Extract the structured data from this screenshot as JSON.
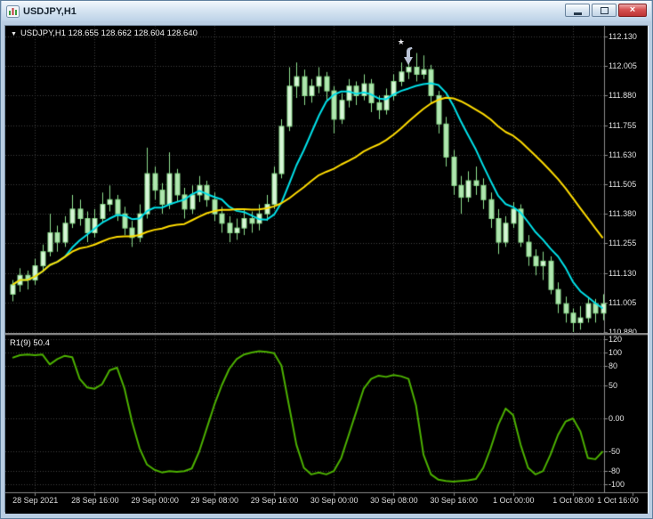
{
  "window": {
    "title": "USDJPY,H1"
  },
  "legend": {
    "collapse_glyph": "▼",
    "symbol": "USDJPY,H1",
    "ohlc": "128.655 128.662 128.604 128.640"
  },
  "theme": {
    "chart_bg": "#000000",
    "grid": "#3f3f3f",
    "separator": "#8a8a8a",
    "scale_text": "#e2e2e2",
    "candle_up_fill": "#d8f6d8",
    "candle_down_fill": "#b0e6b0",
    "candle_stroke": "#8cdc8c",
    "frame": "#b9cde2",
    "close_button_red": "#bc3434"
  },
  "chart_data": {
    "type": "candlestick",
    "symbol": "USDJPY",
    "timeframe": "H1",
    "price_axis": {
      "min": 110.88,
      "max": 112.13,
      "tick_step": 0.125,
      "labels": [
        {
          "text": "112.130",
          "value": 112.13
        },
        {
          "text": "112.005",
          "value": 112.005
        },
        {
          "text": "111.880",
          "value": 111.88
        },
        {
          "text": "111.755",
          "value": 111.755
        },
        {
          "text": "111.630",
          "value": 111.63
        },
        {
          "text": "111.505",
          "value": 111.505
        },
        {
          "text": "111.380",
          "value": 111.38
        },
        {
          "text": "111.255",
          "value": 111.255
        },
        {
          "text": "111.130",
          "value": 111.13
        },
        {
          "text": "111.005",
          "value": 111.005
        },
        {
          "text": "110.880",
          "value": 110.88
        }
      ]
    },
    "time_axis": {
      "labels": [
        {
          "text": "28 Sep 2021",
          "bar": 3
        },
        {
          "text": "28 Sep 16:00",
          "bar": 11
        },
        {
          "text": "29 Sep 00:00",
          "bar": 19
        },
        {
          "text": "29 Sep 08:00",
          "bar": 27
        },
        {
          "text": "29 Sep 16:00",
          "bar": 35
        },
        {
          "text": "30 Sep 00:00",
          "bar": 43
        },
        {
          "text": "30 Sep 08:00",
          "bar": 51
        },
        {
          "text": "30 Sep 16:00",
          "bar": 59
        },
        {
          "text": "1 Oct 00:00",
          "bar": 67
        },
        {
          "text": "1 Oct 08:00",
          "bar": 75
        },
        {
          "text": "1 Oct 16:00",
          "bar": 83
        }
      ]
    },
    "candles": [
      [
        111.04,
        111.1,
        111.01,
        111.08
      ],
      [
        111.08,
        111.15,
        111.05,
        111.12
      ],
      [
        111.12,
        111.14,
        111.06,
        111.1
      ],
      [
        111.1,
        111.19,
        111.08,
        111.16
      ],
      [
        111.16,
        111.25,
        111.14,
        111.22
      ],
      [
        111.22,
        111.38,
        111.2,
        111.3
      ],
      [
        111.3,
        111.33,
        111.22,
        111.26
      ],
      [
        111.26,
        111.37,
        111.24,
        111.34
      ],
      [
        111.34,
        111.46,
        111.32,
        111.4
      ],
      [
        111.4,
        111.44,
        111.33,
        111.36
      ],
      [
        111.36,
        111.39,
        111.26,
        111.3
      ],
      [
        111.3,
        111.4,
        111.28,
        111.36
      ],
      [
        111.36,
        111.47,
        111.34,
        111.42
      ],
      [
        111.42,
        111.5,
        111.39,
        111.44
      ],
      [
        111.44,
        111.46,
        111.35,
        111.38
      ],
      [
        111.38,
        111.41,
        111.29,
        111.32
      ],
      [
        111.32,
        111.35,
        111.24,
        111.28
      ],
      [
        111.28,
        111.42,
        111.26,
        111.38
      ],
      [
        111.38,
        111.66,
        111.36,
        111.55
      ],
      [
        111.55,
        111.58,
        111.44,
        111.48
      ],
      [
        111.48,
        111.51,
        111.38,
        111.42
      ],
      [
        111.42,
        111.64,
        111.4,
        111.55
      ],
      [
        111.55,
        111.57,
        111.43,
        111.46
      ],
      [
        111.46,
        111.49,
        111.36,
        111.4
      ],
      [
        111.4,
        111.5,
        111.38,
        111.46
      ],
      [
        111.46,
        111.54,
        111.43,
        111.5
      ],
      [
        111.5,
        111.52,
        111.41,
        111.44
      ],
      [
        111.44,
        111.47,
        111.35,
        111.38
      ],
      [
        111.38,
        111.41,
        111.3,
        111.34
      ],
      [
        111.34,
        111.37,
        111.26,
        111.3
      ],
      [
        111.3,
        111.36,
        111.27,
        111.32
      ],
      [
        111.32,
        111.4,
        111.29,
        111.36
      ],
      [
        111.36,
        111.39,
        111.3,
        111.34
      ],
      [
        111.34,
        111.42,
        111.31,
        111.38
      ],
      [
        111.38,
        111.46,
        111.35,
        111.42
      ],
      [
        111.42,
        111.58,
        111.4,
        111.55
      ],
      [
        111.55,
        111.78,
        111.53,
        111.75
      ],
      [
        111.75,
        112.0,
        111.73,
        111.92
      ],
      [
        111.92,
        112.02,
        111.87,
        111.96
      ],
      [
        111.96,
        111.99,
        111.84,
        111.88
      ],
      [
        111.88,
        111.95,
        111.85,
        111.92
      ],
      [
        111.92,
        112.0,
        111.89,
        111.96
      ],
      [
        111.96,
        111.98,
        111.86,
        111.9
      ],
      [
        111.9,
        111.92,
        111.72,
        111.78
      ],
      [
        111.78,
        111.89,
        111.76,
        111.86
      ],
      [
        111.86,
        111.95,
        111.83,
        111.92
      ],
      [
        111.92,
        111.94,
        111.84,
        111.88
      ],
      [
        111.88,
        111.97,
        111.86,
        111.93
      ],
      [
        111.93,
        111.95,
        111.81,
        111.85
      ],
      [
        111.85,
        111.88,
        111.78,
        111.82
      ],
      [
        111.82,
        111.91,
        111.8,
        111.88
      ],
      [
        111.88,
        111.97,
        111.86,
        111.94
      ],
      [
        111.94,
        112.02,
        111.92,
        111.98
      ],
      [
        111.98,
        112.05,
        111.95,
        112.0
      ],
      [
        112.0,
        112.06,
        111.94,
        111.97
      ],
      [
        111.97,
        112.05,
        111.95,
        111.99
      ],
      [
        111.99,
        112.01,
        111.85,
        111.88
      ],
      [
        111.88,
        111.9,
        111.72,
        111.76
      ],
      [
        111.76,
        111.79,
        111.58,
        111.62
      ],
      [
        111.62,
        111.65,
        111.46,
        111.5
      ],
      [
        111.5,
        111.54,
        111.38,
        111.45
      ],
      [
        111.45,
        111.56,
        111.43,
        111.52
      ],
      [
        111.52,
        111.58,
        111.46,
        111.5
      ],
      [
        111.5,
        111.53,
        111.4,
        111.44
      ],
      [
        111.44,
        111.47,
        111.32,
        111.36
      ],
      [
        111.36,
        111.4,
        111.21,
        111.26
      ],
      [
        111.26,
        111.37,
        111.24,
        111.34
      ],
      [
        111.34,
        111.43,
        111.32,
        111.4
      ],
      [
        111.4,
        111.42,
        111.24,
        111.26
      ],
      [
        111.26,
        111.29,
        111.16,
        111.2
      ],
      [
        111.2,
        111.23,
        111.12,
        111.16
      ],
      [
        111.16,
        111.22,
        111.1,
        111.18
      ],
      [
        111.18,
        111.2,
        111.04,
        111.06
      ],
      [
        111.06,
        111.09,
        110.96,
        111.0
      ],
      [
        111.0,
        111.03,
        110.92,
        110.96
      ],
      [
        110.96,
        110.98,
        110.88,
        110.92
      ],
      [
        110.92,
        110.99,
        110.89,
        110.94
      ],
      [
        110.94,
        111.03,
        110.92,
        111.0
      ],
      [
        111.0,
        111.02,
        110.92,
        110.96
      ],
      [
        110.96,
        111.04,
        110.93,
        111.0
      ]
    ],
    "moving_averages": [
      {
        "name": "ma-fast",
        "period": 8,
        "color": "#00e0e8"
      },
      {
        "name": "ma-slow",
        "period": 24,
        "color": "#ffdc00"
      }
    ],
    "oscillator": {
      "name": "R1(9)",
      "value_label": "50.4",
      "color": "#4cb000",
      "axis_labels": [
        {
          "text": "120",
          "value": 120
        },
        {
          "text": "100",
          "value": 100
        },
        {
          "text": "80",
          "value": 80
        },
        {
          "text": "50",
          "value": 50
        },
        {
          "text": "0.00",
          "value": 0
        },
        {
          "text": "-50",
          "value": -50
        },
        {
          "text": "-80",
          "value": -80
        },
        {
          "text": "-100",
          "value": -100
        }
      ],
      "values": [
        92,
        96,
        97,
        96,
        97,
        82,
        90,
        95,
        93,
        60,
        47,
        45,
        52,
        73,
        77,
        45,
        -5,
        -45,
        -70,
        -78,
        -82,
        -80,
        -81,
        -80,
        -76,
        -50,
        -15,
        20,
        50,
        75,
        90,
        97,
        100,
        102,
        101,
        99,
        80,
        20,
        -40,
        -75,
        -85,
        -82,
        -85,
        -80,
        -60,
        -25,
        10,
        45,
        60,
        65,
        63,
        66,
        64,
        60,
        20,
        -55,
        -85,
        -93,
        -95,
        -96,
        -95,
        -94,
        -92,
        -75,
        -45,
        -10,
        15,
        5,
        -40,
        -75,
        -85,
        -80,
        -55,
        -25,
        -5,
        0,
        -20,
        -60,
        -62,
        -50
      ]
    },
    "markers": [
      {
        "name": "star-marker",
        "glyph": "★",
        "bar": 52,
        "price": 112.105,
        "color": "#e6e6ea"
      },
      {
        "name": "sell-arrow-marker",
        "bar": 53,
        "price": 112.005,
        "color": "#b9c2d4"
      }
    ]
  }
}
